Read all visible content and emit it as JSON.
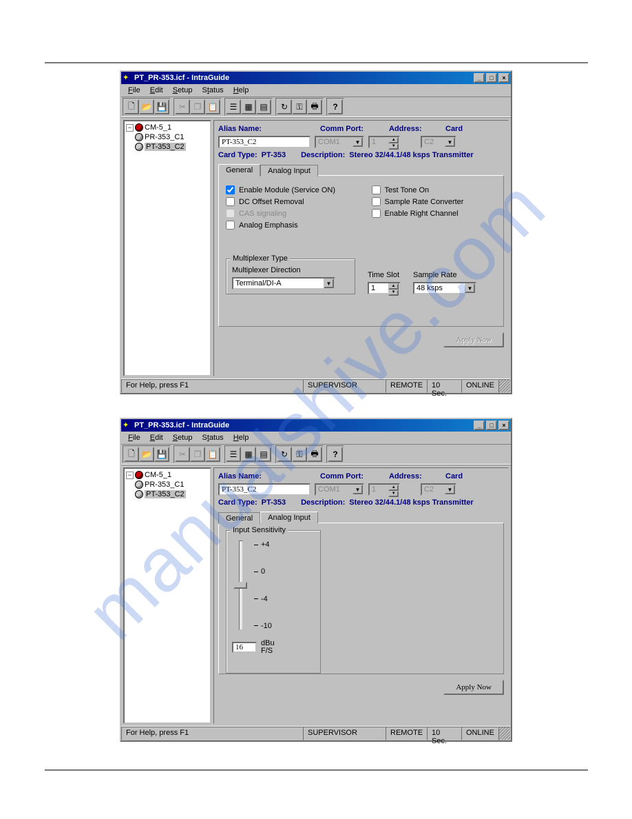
{
  "windows": [
    {
      "title": "PT_PR-353.icf - IntraGuide",
      "menu": [
        "File",
        "Edit",
        "Setup",
        "Status",
        "Help"
      ],
      "tree": {
        "root": "CM-5_1",
        "children": [
          {
            "label": "PR-353_C1"
          },
          {
            "label": "PT-353_C2",
            "selected": true
          }
        ]
      },
      "header": {
        "alias_label": "Alias Name:",
        "alias_value": "PT-353_C2",
        "comm_label": "Comm Port:",
        "comm_value": "COM1",
        "addr_label": "Address:",
        "addr_value": "1",
        "card_label": "Card",
        "card_value": "C2",
        "cardtype_label": "Card Type:",
        "cardtype_value": "PT-353",
        "desc_label": "Description:",
        "desc_value": "Stereo 32/44.1/48 ksps Transmitter"
      },
      "active_tab": "General",
      "tabs": [
        "General",
        "Analog Input"
      ],
      "general": {
        "enable_module": {
          "label": "Enable Module (Service ON)",
          "checked": true
        },
        "dc_offset": {
          "label": "DC Offset Removal",
          "checked": false
        },
        "cas_signaling": {
          "label": "CAS signaling",
          "disabled": true
        },
        "analog_emphasis": {
          "label": "Analog Emphasis",
          "checked": false
        },
        "test_tone": {
          "label": "Test Tone On",
          "checked": false
        },
        "sample_rate_conv": {
          "label": "Sample Rate Converter",
          "checked": false
        },
        "enable_right": {
          "label": "Enable Right Channel",
          "checked": false
        },
        "mux_legend": "Multiplexer Type",
        "mux_dir_label": "Multiplexer Direction",
        "mux_dir_value": "Terminal/DI-A",
        "time_slot_label": "Time Slot",
        "time_slot_value": "1",
        "sample_rate_label": "Sample Rate",
        "sample_rate_value": "48 ksps"
      },
      "apply_label": "Apply Now",
      "apply_disabled": true,
      "status": {
        "help": "For Help, press F1",
        "role": "SUPERVISOR",
        "mode": "REMOTE",
        "interval": "10 Sec.",
        "conn": "ONLINE"
      }
    },
    {
      "title": "PT_PR-353.icf - IntraGuide",
      "menu": [
        "File",
        "Edit",
        "Setup",
        "Status",
        "Help"
      ],
      "tree": {
        "root": "CM-5_1",
        "children": [
          {
            "label": "PR-353_C1"
          },
          {
            "label": "PT-353_C2",
            "selected": true
          }
        ]
      },
      "header": {
        "alias_label": "Alias Name:",
        "alias_value": "PT-353_C2",
        "comm_label": "Comm Port:",
        "comm_value": "COM1",
        "addr_label": "Address:",
        "addr_value": "1",
        "card_label": "Card",
        "card_value": "C2",
        "cardtype_label": "Card Type:",
        "cardtype_value": "PT-353",
        "desc_label": "Description:",
        "desc_value": "Stereo 32/44.1/48 ksps Transmitter"
      },
      "active_tab": "Analog Input",
      "tabs": [
        "General",
        "Analog Input"
      ],
      "analog": {
        "legend": "Input Sensitivity",
        "ticks": [
          "+4",
          "0",
          "-4",
          "-10"
        ],
        "value": "16",
        "unit1": "dBu",
        "unit2": "F/S"
      },
      "apply_label": "Apply Now",
      "apply_disabled": false,
      "status": {
        "help": "For Help, press F1",
        "role": "SUPERVISOR",
        "mode": "REMOTE",
        "interval": "10 Sec.",
        "conn": "ONLINE"
      }
    }
  ],
  "chart_data": {
    "type": "scatter",
    "title": "Input Sensitivity",
    "ylabel": "dBu F/S",
    "ylim": [
      -16,
      4
    ],
    "values": [
      -16
    ],
    "ticks": [
      4,
      0,
      -4,
      -10
    ]
  }
}
